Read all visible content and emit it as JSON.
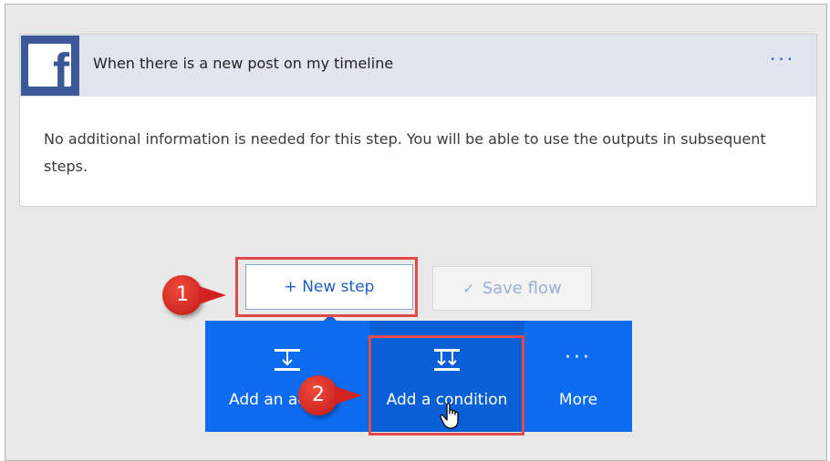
{
  "trigger_card": {
    "icon": "facebook-icon",
    "title": "When there is a new post on my timeline",
    "more_icon": "ellipsis-icon",
    "more_label": "···",
    "body_text": "No additional information is needed for this step. You will be able to use the outputs in subsequent steps."
  },
  "toolbar": {
    "new_step_label": "+ New step",
    "save_flow_label": "Save flow",
    "save_flow_icon": "checkmark-icon"
  },
  "action_menu": {
    "items": [
      {
        "label": "Add an action",
        "icon": "add-action-icon"
      },
      {
        "label": "Add a condition",
        "icon": "add-condition-icon"
      },
      {
        "label": "More",
        "icon": "ellipsis-icon",
        "icon_glyph": "···"
      }
    ]
  },
  "callouts": {
    "one": "1",
    "two": "2"
  },
  "colors": {
    "facebook_blue": "#3b5998",
    "menu_blue": "#0d6bf0",
    "highlight_red": "#e04a4a",
    "header_bg": "#e1e5f0",
    "link_blue": "#1f5fbf"
  }
}
